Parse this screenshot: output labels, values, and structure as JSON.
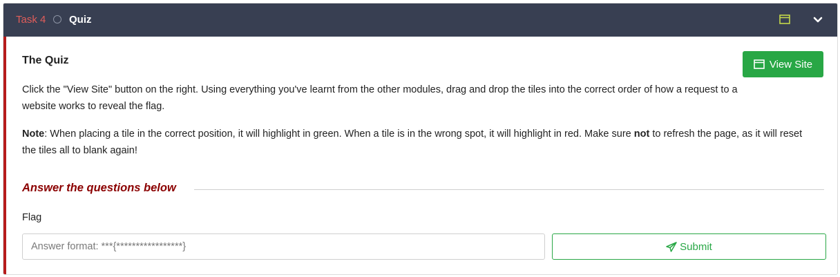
{
  "task": {
    "number_label": "Task 4",
    "title": "Quiz",
    "icons": {
      "status": "circle-icon",
      "split_view": "split-view-icon",
      "collapse": "chevron-down-icon"
    },
    "accent_color": "#e05d5a"
  },
  "content": {
    "heading": "The Quiz",
    "view_site_label": "View Site",
    "paragraph1": "Click the \"View Site\" button on the right. Using everything you've learnt from the other modules, drag and drop the tiles into the correct order of how a request to a website works to reveal the flag.",
    "note_label": "Note",
    "note_part1": ": When placing a tile in the correct position, it will highlight in green. When a tile is in the wrong spot, it will highlight in red. Make sure ",
    "note_bold": "not",
    "note_part2": " to refresh the page, as it will reset the tiles all to blank again!"
  },
  "questions": {
    "section_title": "Answer the questions below",
    "items": [
      {
        "label": "Flag",
        "placeholder": "Answer format: ***{*****************}",
        "value": "",
        "submit_label": "Submit"
      }
    ]
  },
  "colors": {
    "header_bg": "#383f52",
    "success": "#28a745",
    "section_red": "#8b0000",
    "left_border": "#b71c1c"
  }
}
